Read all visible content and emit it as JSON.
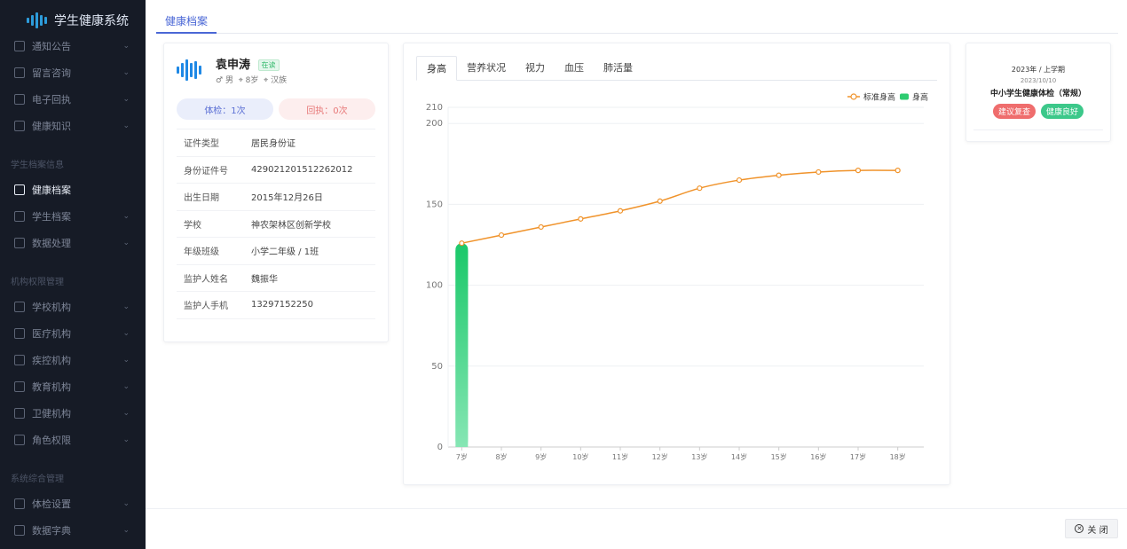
{
  "app": {
    "title": "学生健康系统"
  },
  "sidebar": {
    "top_items": [
      {
        "label": "通知公告",
        "icon": "megaphone-icon"
      },
      {
        "label": "留言咨询",
        "icon": "message-icon"
      },
      {
        "label": "电子回执",
        "icon": "receipt-icon"
      },
      {
        "label": "健康知识",
        "icon": "heart-icon"
      }
    ],
    "groups": [
      {
        "title": "学生档案信息",
        "items": [
          {
            "label": "健康档案",
            "icon": "file-plus-icon",
            "active": true
          },
          {
            "label": "学生档案",
            "icon": "users-icon"
          },
          {
            "label": "数据处理",
            "icon": "network-icon"
          }
        ]
      },
      {
        "title": "机构权限管理",
        "items": [
          {
            "label": "学校机构",
            "icon": "school-icon"
          },
          {
            "label": "医疗机构",
            "icon": "hospital-icon"
          },
          {
            "label": "疾控机构",
            "icon": "shield-icon"
          },
          {
            "label": "教育机构",
            "icon": "book-icon"
          },
          {
            "label": "卫健机构",
            "icon": "building-icon"
          },
          {
            "label": "角色权限",
            "icon": "role-icon"
          }
        ]
      },
      {
        "title": "系统综合管理",
        "items": [
          {
            "label": "体检设置",
            "icon": "clock-icon"
          },
          {
            "label": "数据字典",
            "icon": "layers-icon"
          }
        ]
      }
    ]
  },
  "tabbar": {
    "active_tab": "健康档案"
  },
  "profile": {
    "name": "袁申涛",
    "status": "在读",
    "gender": "男",
    "age": "8岁",
    "ethnicity": "汉族",
    "exam_count": "体检：1次",
    "receipt_count": "回执：0次",
    "fields": [
      {
        "key": "证件类型",
        "value": "居民身份证"
      },
      {
        "key": "身份证件号",
        "value": "429021201512262012"
      },
      {
        "key": "出生日期",
        "value": "2015年12月26日"
      },
      {
        "key": "学校",
        "value": "神农架林区创新学校"
      },
      {
        "key": "年级班级",
        "value": "小学二年级 / 1班"
      },
      {
        "key": "监护人姓名",
        "value": "魏振华"
      },
      {
        "key": "监护人手机",
        "value": "13297152250"
      }
    ]
  },
  "chart_tabs": [
    "身高",
    "营养状况",
    "视力",
    "血压",
    "肺活量"
  ],
  "chart_data": {
    "type": "bar",
    "categories": [
      "7岁",
      "8岁",
      "9岁",
      "10岁",
      "11岁",
      "12岁",
      "13岁",
      "14岁",
      "15岁",
      "16岁",
      "17岁",
      "18岁"
    ],
    "series": [
      {
        "name": "标准身高",
        "type": "line",
        "values": [
          126,
          131,
          136,
          141,
          146,
          152,
          160,
          165,
          168,
          170,
          171,
          171
        ],
        "color": "#f0932b"
      },
      {
        "name": "身高",
        "type": "bar",
        "values": [
          126,
          null,
          null,
          null,
          null,
          null,
          null,
          null,
          null,
          null,
          null,
          null
        ],
        "color": "#2ecc71"
      }
    ],
    "yticks": [
      0,
      50,
      100,
      150,
      200,
      210
    ],
    "ylim": [
      0,
      210
    ],
    "legend": "top-right",
    "grid": true
  },
  "exam": {
    "semester": "2023年 / 上学期",
    "date": "2023/10/10",
    "title": "中小学生健康体检（常规）",
    "tags": [
      "建议复查",
      "健康良好"
    ]
  },
  "footer": {
    "close_label": "关 闭"
  }
}
